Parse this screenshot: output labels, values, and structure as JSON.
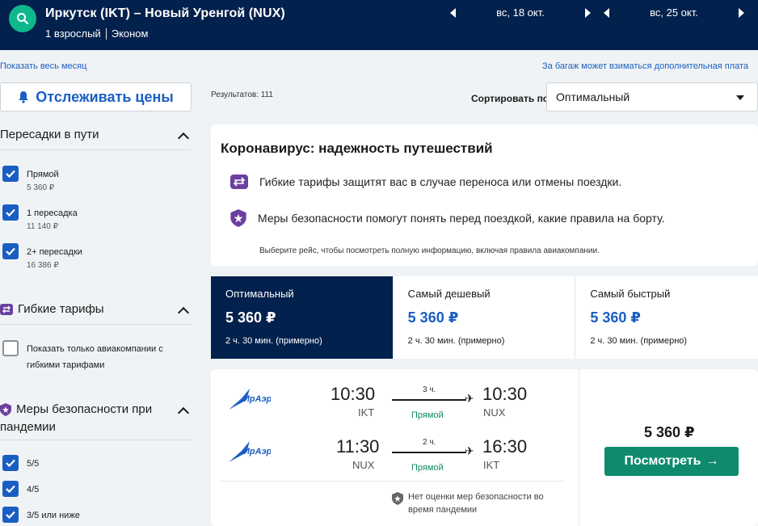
{
  "header": {
    "route": "Иркутск (IKT) – Новый Уренгой (NUX)",
    "passengers": "1 взрослый",
    "cabin": "Эконом",
    "depart_date": "вс, 18 окт.",
    "return_date": "вс, 25 окт."
  },
  "links": {
    "show_month": "Показать весь месяц",
    "baggage": "За багаж может взиматься дополнительная плата"
  },
  "sidebar": {
    "track_prices": "Отслеживать цены",
    "stops": {
      "title": "Пересадки в пути",
      "items": [
        {
          "label": "Прямой",
          "price": "5 360 ₽",
          "checked": true
        },
        {
          "label": "1 пересадка",
          "price": "11 140 ₽",
          "checked": true
        },
        {
          "label": "2+ пересадки",
          "price": "16 386 ₽",
          "checked": true
        }
      ]
    },
    "flexible": {
      "title": "Гибкие тарифы",
      "option_line1": "Показать только авиакомпании с",
      "option_line2": "гибкими тарифами"
    },
    "safety": {
      "title_line1": "Меры безопасности при",
      "title_line2": "пандемии",
      "items": [
        {
          "label": "5/5",
          "checked": true
        },
        {
          "label": "4/5",
          "checked": true
        },
        {
          "label": "3/5 или ниже",
          "checked": true
        }
      ]
    }
  },
  "results": {
    "count": "Результатов: 111",
    "sort_label": "Сортировать по",
    "sort_value": "Оптимальный"
  },
  "covid": {
    "title": "Коронавирус: надежность путешествий",
    "flexible": "Гибкие тарифы защитят вас в случае переноса или отмены поездки.",
    "safety": "Меры безопасности помогут понять перед поездкой, какие правила на борту.",
    "note": "Выберите рейс, чтобы посмотреть полную информацию, включая правила авиакомпании."
  },
  "tabs": [
    {
      "name": "Оптимальный",
      "price": "5 360 ₽",
      "duration": "2 ч. 30 мин. (примерно)",
      "active": true
    },
    {
      "name": "Самый дешевый",
      "price": "5 360 ₽",
      "duration": "2 ч. 30 мин. (примерно)",
      "active": false
    },
    {
      "name": "Самый быстрый",
      "price": "5 360 ₽",
      "duration": "2 ч. 30 мин. (примерно)",
      "active": false
    }
  ],
  "flight": {
    "airline_logo_text": "ИрАэро",
    "legs": [
      {
        "dep_time": "10:30",
        "dep_code": "IKT",
        "arr_time": "10:30",
        "arr_code": "NUX",
        "duration": "3 ч.",
        "stops": "Прямой"
      },
      {
        "dep_time": "11:30",
        "dep_code": "NUX",
        "arr_time": "16:30",
        "arr_code": "IKT",
        "duration": "2 ч.",
        "stops": "Прямой"
      }
    ],
    "safety_note_line1": "Нет оценки мер безопасности во",
    "safety_note_line2": "время пандемии",
    "price": "5 360 ₽",
    "view_button": "Посмотреть"
  },
  "colors": {
    "header_bg": "#02214c",
    "accent_blue": "#1a5ec3",
    "search_green": "#0fb78e",
    "cta_green": "#0f8a6f"
  }
}
